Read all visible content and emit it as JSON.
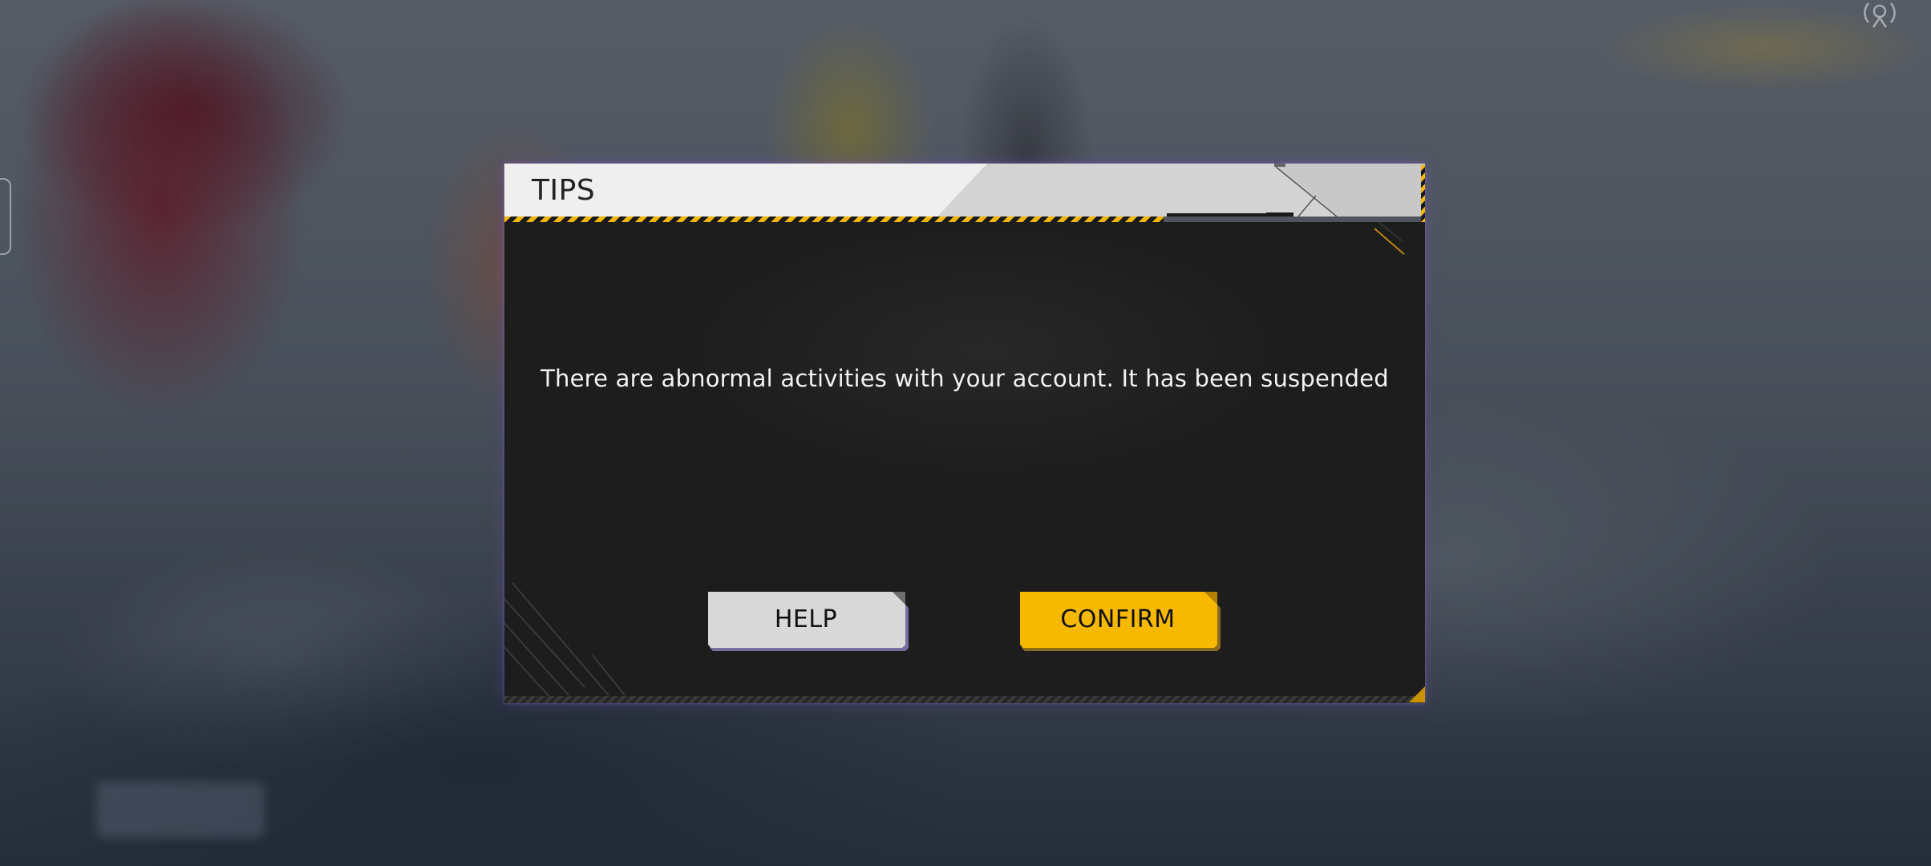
{
  "dialog": {
    "title": "TIPS",
    "message": "There are abnormal activities with your account. It has been suspended",
    "buttons": {
      "help_label": "HELP",
      "confirm_label": "CONFIRM"
    }
  },
  "colors": {
    "accent_yellow": "#f7b900",
    "header_bg": "#efefef",
    "body_bg": "#1d1d1d",
    "help_button_bg": "#d8d8d8",
    "text_light": "#f2f2f2"
  },
  "icons": {
    "top_right": "signal-target-icon"
  }
}
